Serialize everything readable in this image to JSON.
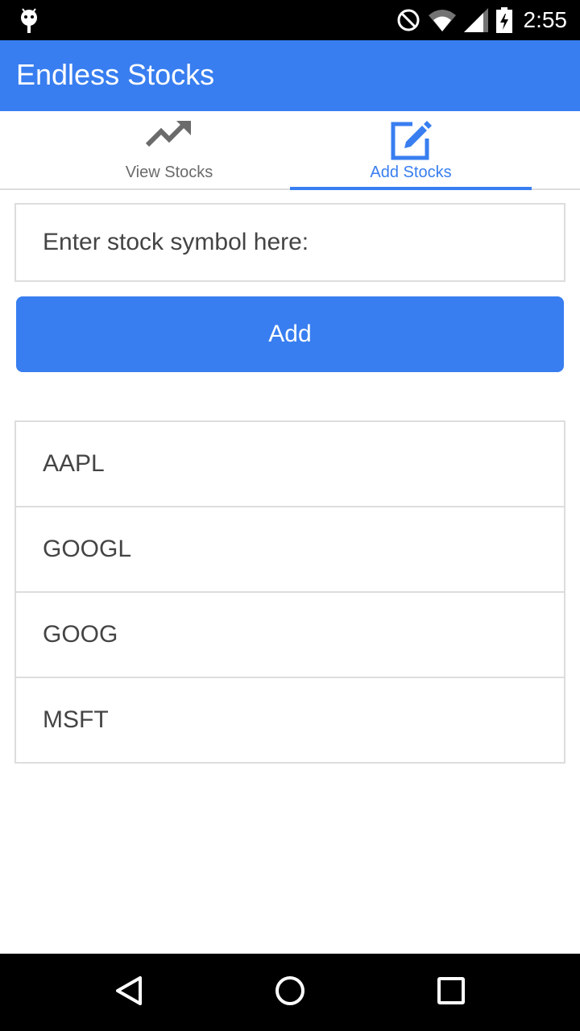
{
  "status_bar": {
    "time": "2:55",
    "icons": [
      "android-debug-icon",
      "do-not-disturb-icon",
      "wifi-icon",
      "cell-signal-icon",
      "battery-charging-icon"
    ]
  },
  "app_bar": {
    "title": "Endless Stocks",
    "color": "#387ef0"
  },
  "tabs": [
    {
      "label": "View Stocks",
      "icon": "trending-up-icon",
      "selected": false
    },
    {
      "label": "Add Stocks",
      "icon": "edit-icon",
      "selected": true
    }
  ],
  "form": {
    "symbol_placeholder": "Enter stock symbol here:",
    "symbol_value": "",
    "add_label": "Add"
  },
  "stocks": [
    {
      "symbol": "AAPL"
    },
    {
      "symbol": "GOOGL"
    },
    {
      "symbol": "GOOG"
    },
    {
      "symbol": "MSFT"
    }
  ],
  "nav_bar": {
    "icons": [
      "back-icon",
      "home-icon",
      "recents-icon"
    ]
  }
}
